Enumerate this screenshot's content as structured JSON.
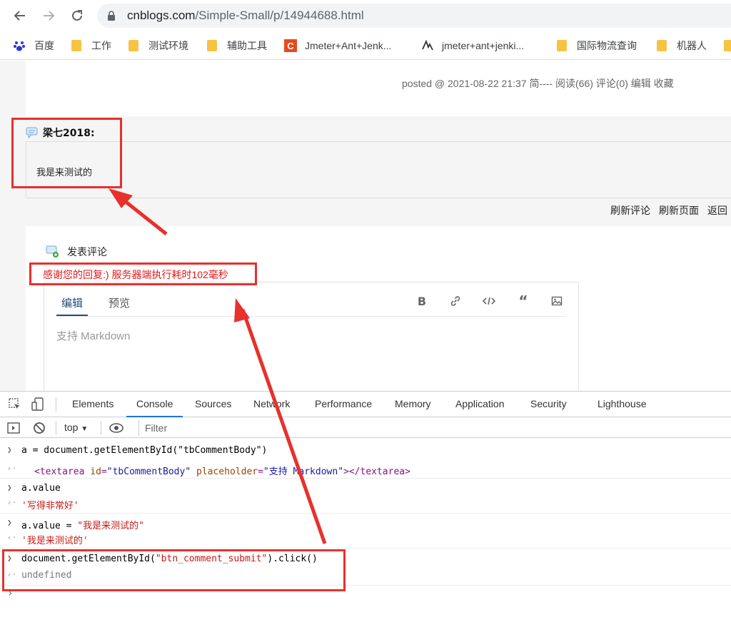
{
  "browser": {
    "url_host": "cnblogs.com",
    "url_path": "/Simple-Small/p/14944688.html",
    "bookmarks": [
      {
        "label": "百度",
        "icon": "baidu-icon"
      },
      {
        "label": "工作",
        "icon": "folder-icon"
      },
      {
        "label": "测试环境",
        "icon": "folder-icon"
      },
      {
        "label": "辅助工具",
        "icon": "folder-icon"
      },
      {
        "label": "Jmeter+Ant+Jenk...",
        "icon": "site-c-icon"
      },
      {
        "label": "jmeter+ant+jenki...",
        "icon": "site-glyph-icon"
      },
      {
        "label": "国际物流查询",
        "icon": "folder-icon"
      },
      {
        "label": "机器人",
        "icon": "folder-icon"
      }
    ]
  },
  "post": {
    "meta": "posted @ 2021-08-22 21:37  简----  阅读(66)  评论(0)  编辑  收藏"
  },
  "comment": {
    "author": "梁七2018:",
    "text": "我是来测试的"
  },
  "comment_actions": {
    "refresh_comments": "刷新评论",
    "refresh_page": "刷新页面",
    "back": "返回"
  },
  "form": {
    "title": "发表评论",
    "success_message": "感谢您的回复:) 服务器端执行耗时102毫秒",
    "tab_edit": "编辑",
    "tab_preview": "预览",
    "placeholder": "支持 Markdown"
  },
  "devtools": {
    "tabs": [
      "Elements",
      "Console",
      "Sources",
      "Network",
      "Performance",
      "Memory",
      "Application",
      "Security",
      "Lighthouse"
    ],
    "active_tab": "Console",
    "context": "top",
    "filter_placeholder": "Filter",
    "console": {
      "l1": "a = document.getElementById(\"tbCommentBody\")",
      "l2_tag_open": "<textarea",
      "l2_attr1_name": "id",
      "l2_attr1_val": "\"tbCommentBody\"",
      "l2_attr2_name": "placeholder",
      "l2_attr2_val": "\"支持 Markdown\"",
      "l2_tag_close": "></textarea>",
      "l3": "a.value",
      "l4": "'写得非常好'",
      "l5_lhs": "a.value = ",
      "l5_rhs": "\"我是来测试的\"",
      "l6": "'我是来测试的'",
      "l7_pre": "document.getElementById(",
      "l7_str": "\"btn_comment_submit\"",
      "l7_post": ").click()",
      "l8": "undefined"
    }
  },
  "colors": {
    "annotation": "#e8302c",
    "devtools_accent": "#1a73e8"
  }
}
